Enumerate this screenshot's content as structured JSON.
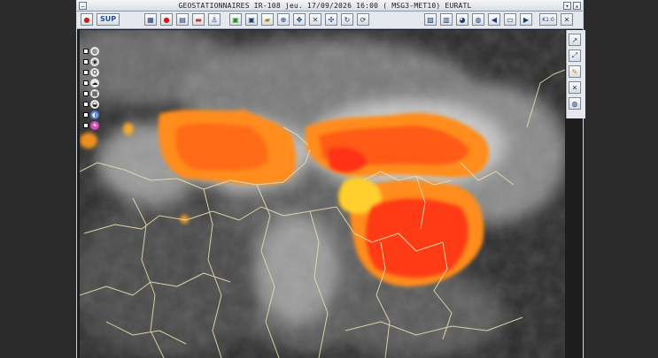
{
  "window": {
    "title": "GEOSTATIONNAIRES IR-108 jeu. 17/09/2026 16:00 (     MSG3-MET10) EURATL"
  },
  "toolbar": {
    "sup_label": "SUP",
    "close_icon": "stop-icon",
    "zoom_label": "K1:0"
  },
  "layers": [
    {
      "icon": "contour-icon"
    },
    {
      "icon": "eye-icon"
    },
    {
      "icon": "search-icon"
    },
    {
      "icon": "cloud-icon"
    },
    {
      "icon": "grid-icon"
    },
    {
      "icon": "weather-icon"
    },
    {
      "icon": "globe-icon"
    },
    {
      "icon": "sun-icon"
    }
  ],
  "colors": {
    "cloud_hot": "#ff3b14",
    "cloud_warm": "#ff7a16",
    "cloud_mid": "#ffb12a",
    "cloud_cool": "#ffe24a",
    "border": "#e6d8a8"
  }
}
